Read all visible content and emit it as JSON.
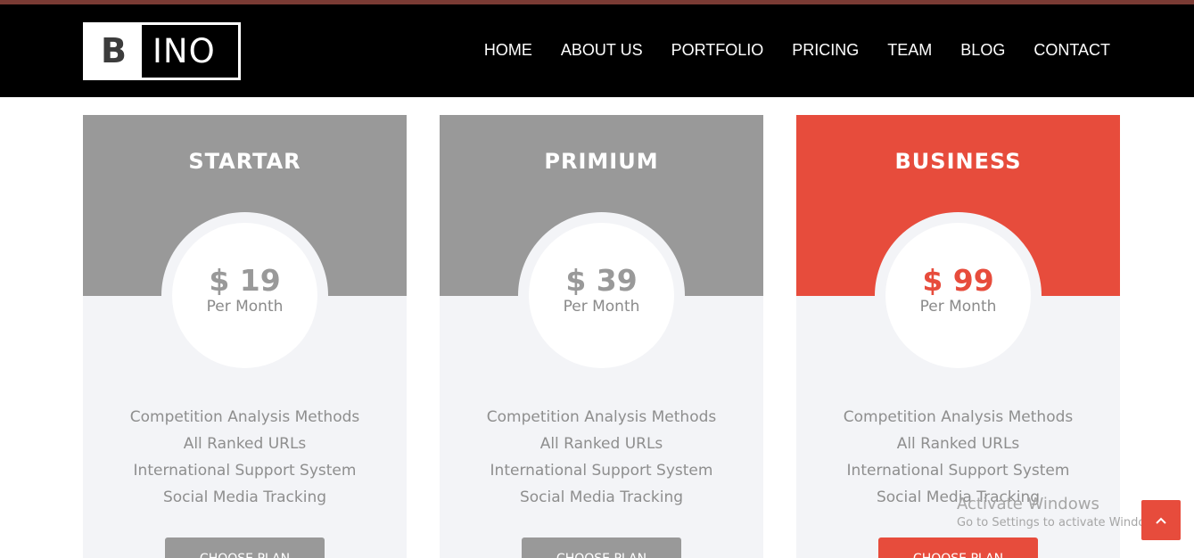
{
  "brand": {
    "logo_left": "B",
    "logo_right": "INO"
  },
  "nav": {
    "items": [
      {
        "label": "HOME"
      },
      {
        "label": "ABOUT US"
      },
      {
        "label": "PORTFOLIO"
      },
      {
        "label": "PRICING"
      },
      {
        "label": "TEAM"
      },
      {
        "label": "BLOG"
      },
      {
        "label": "CONTACT"
      }
    ]
  },
  "plans": [
    {
      "name": "STARTAR",
      "price": "$ 19",
      "period": "Per Month",
      "button": "CHOOSE PLAN",
      "accent": "#999999",
      "features": [
        "Competition Analysis Methods",
        "All Ranked URLs",
        "International Support System",
        "Social Media Tracking"
      ]
    },
    {
      "name": "PRIMIUM",
      "price": "$ 39",
      "period": "Per Month",
      "button": "CHOOSE PLAN",
      "accent": "#999999",
      "features": [
        "Competition Analysis Methods",
        "All Ranked URLs",
        "International Support System",
        "Social Media Tracking"
      ]
    },
    {
      "name": "BUSINESS",
      "price": "$ 99",
      "period": "Per Month",
      "button": "CHOOSE PLAN",
      "accent": "#e74c3c",
      "features": [
        "Competition Analysis Methods",
        "All Ranked URLs",
        "International Support System",
        "Social Media Tracking"
      ]
    }
  ],
  "watermark": {
    "line1": "Activate Windows",
    "line2": "Go to Settings to activate Windows."
  },
  "back_to_top": {
    "icon": "chevron-up-icon"
  }
}
